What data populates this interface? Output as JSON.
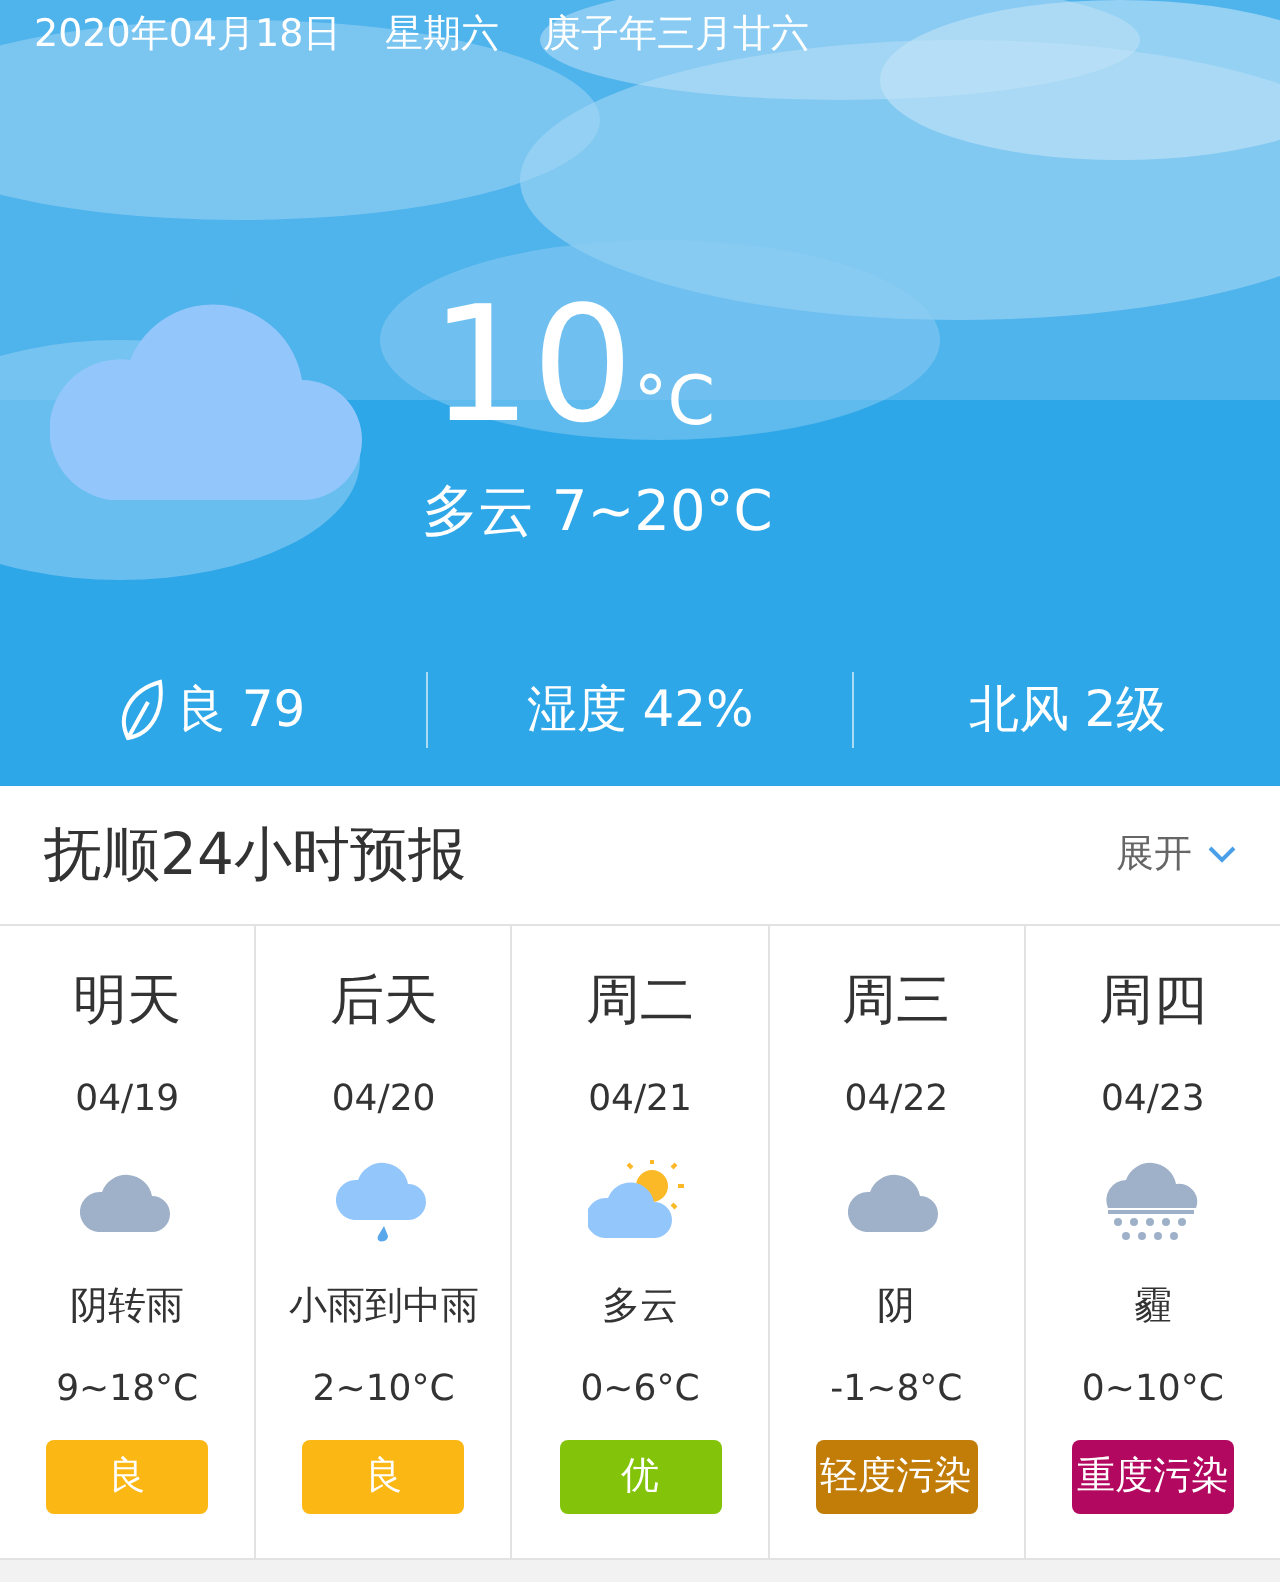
{
  "date_line": [
    "2020年04月18日",
    "星期六",
    "庚子年三月廿六"
  ],
  "current": {
    "kind": "cloudy_night",
    "temp": "10",
    "unit": "°C",
    "summary": "多云 7~20°C"
  },
  "stats": [
    {
      "kind": "aqi",
      "text": "良 79"
    },
    {
      "kind": "plain",
      "text": "湿度 42%"
    },
    {
      "kind": "plain",
      "text": "北风 2级"
    }
  ],
  "forecast_header": {
    "title": "抚顺24小时预报",
    "toggle": "展开"
  },
  "days": [
    {
      "day": "明天",
      "date": "04/19",
      "kind": "overcast",
      "desc": "阴转雨",
      "temp": "9~18°C",
      "aqi": "良",
      "color": "#fbb713"
    },
    {
      "day": "后天",
      "date": "04/20",
      "kind": "rain",
      "desc": "小雨到中雨",
      "temp": "2~10°C",
      "aqi": "良",
      "color": "#fbb713"
    },
    {
      "day": "周二",
      "date": "04/21",
      "kind": "partly_cloudy",
      "desc": "多云",
      "temp": "0~6°C",
      "aqi": "优",
      "color": "#83c40a"
    },
    {
      "day": "周三",
      "date": "04/22",
      "kind": "overcast",
      "desc": "阴",
      "temp": "-1~8°C",
      "aqi": "轻度污染",
      "color": "#c17d07"
    },
    {
      "day": "周四",
      "date": "04/23",
      "kind": "haze",
      "desc": "霾",
      "temp": "0~10°C",
      "aqi": "重度污染",
      "color": "#b3085f"
    }
  ]
}
